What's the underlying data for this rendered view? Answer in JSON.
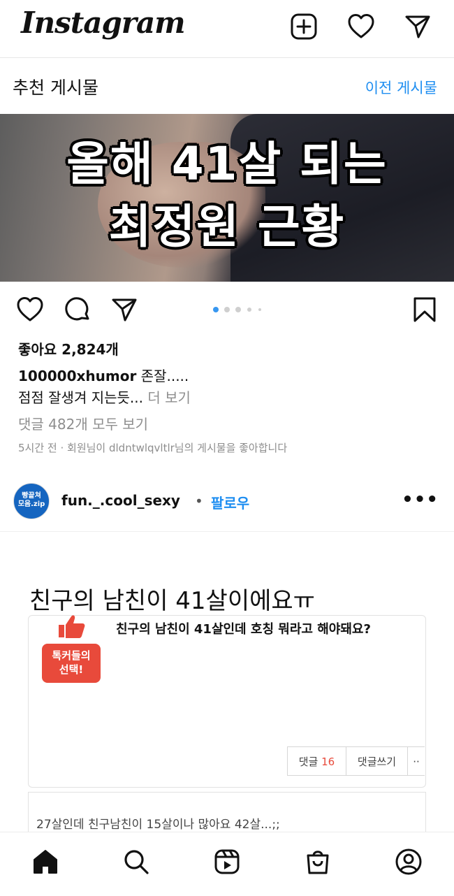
{
  "header": {
    "logo": "Instagram",
    "icons": [
      "add-post-icon",
      "heart-icon",
      "send-icon"
    ]
  },
  "suggested": {
    "title": "추천 게시물",
    "previous_link": "이전 게시물"
  },
  "post1": {
    "image_text_line1": "올해 41살 되는",
    "image_text_line2": "최정원 근황",
    "carousel": {
      "total": 5,
      "active": 1
    },
    "likes": "좋아요 2,824개",
    "caption_user": "100000xhumor",
    "caption_line1": " 존잘.....",
    "caption_line2": "점점 잘생겨 지는듯...",
    "more": " 더 보기",
    "comments": "댓글 482개 모두 보기",
    "meta": "5시간 전 · 회원님이 dldntwlqvltlr님의 게시물을 좋아합니다"
  },
  "post2": {
    "avatar_text_line1": "빵끝쳐",
    "avatar_text_line2": "모음.zip",
    "username": "fun._.cool_sexy",
    "bullet": "•",
    "follow": "팔로우",
    "more_options": "•••",
    "title": "친구의 남친이 41살이에요ㅠ",
    "badge_line1": "톡커들의",
    "badge_line2": "선택!",
    "question": "친구의 남친이 41살인데 호칭 뭐라고 해야돼요?",
    "comment_label": "댓글",
    "comment_count": "16",
    "write_comment": "댓글쓰기",
    "overflow": "··",
    "reply_preview": "27살인데 친구남친이 15살이나 많아요 42살...;;"
  },
  "nav": {
    "items": [
      "home-icon",
      "search-icon",
      "reels-icon",
      "shop-icon",
      "profile-icon"
    ]
  },
  "colors": {
    "link_blue": "#1f8ef1",
    "muted": "#8e8e8e",
    "badge_red": "#e84a3b",
    "active_dot": "#3897f0"
  }
}
